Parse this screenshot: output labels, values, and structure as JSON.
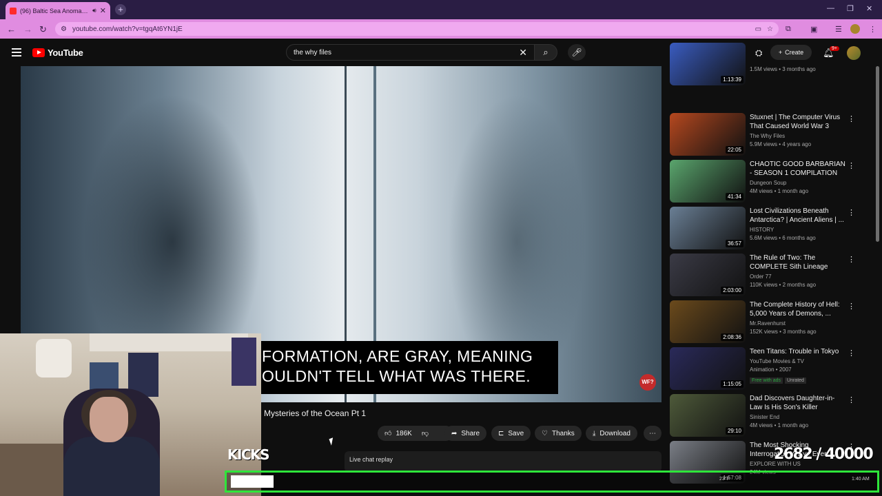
{
  "browser": {
    "tab_title": "(96) Baltic Sea Anomaly, At",
    "url": "youtube.com/watch?v=tgqAt6YN1jE",
    "colors": {
      "accent": "#e08ce0",
      "tabbar": "#2a1d44"
    }
  },
  "youtube": {
    "logo_text": "YouTube",
    "search_value": "the why files",
    "create_label": "Create",
    "notif_count": "9+"
  },
  "video": {
    "caption_line1": "FORMATION, ARE GRAY, MEANING",
    "caption_line2": "OULDN'T TELL WHAT WAS THERE.",
    "channel_badge": "WF?",
    "title": "Mysteries of the Ocean Pt 1",
    "likes": "186K",
    "share_label": "Share",
    "save_label": "Save",
    "thanks_label": "Thanks",
    "download_label": "Download",
    "live_chat_label": "Live chat replay"
  },
  "recommendations": [
    {
      "title": "",
      "channel": "",
      "stats": "1.5M views • 3 months ago",
      "duration": "1:13:39",
      "color": "#3a5cc0"
    },
    {
      "title": "Stuxnet | The Computer Virus That Caused World War 3",
      "channel": "The Why Files",
      "stats": "5.9M views • 4 years ago",
      "duration": "22:05",
      "color": "#b5481f"
    },
    {
      "title": "CHAOTIC GOOD BARBARIAN - SEASON 1 COMPILATION",
      "channel": "Dungeon Soup",
      "stats": "4M views • 1 month ago",
      "duration": "41:34",
      "color": "#5aa56d"
    },
    {
      "title": "Lost Civilizations Beneath Antarctica? | Ancient Aliens | ...",
      "channel": "HISTORY",
      "stats": "5.6M views • 6 months ago",
      "duration": "36:57",
      "color": "#6a7f95"
    },
    {
      "title": "The Rule of Two: The COMPLETE Sith Lineage (Ever...",
      "channel": "Order 77",
      "stats": "110K views • 2 months ago",
      "duration": "2:03:00",
      "color": "#3b3b46"
    },
    {
      "title": "The Complete History of Hell: 5,000 Years of Demons, ...",
      "channel": "Mr.Ravenhurst",
      "stats": "152K views • 3 months ago",
      "duration": "2:08:36",
      "color": "#6b4a1c"
    },
    {
      "title": "Teen Titans: Trouble in Tokyo",
      "channel": "YouTube Movies & TV",
      "stats": "Animation • 2007",
      "duration": "1:15:05",
      "color": "#2a2a5a",
      "badges": [
        "Free with ads",
        "Unrated"
      ]
    },
    {
      "title": "Dad Discovers Daughter-in-Law Is His Son's Killer",
      "channel": "Sinister End",
      "stats": "4M views • 1 month ago",
      "duration": "29:10",
      "color": "#4e5a3a"
    },
    {
      "title": "The Most Shocking Interrogation You've Ever See...",
      "channel": "EXPLORE WITH US",
      "stats": "24M views",
      "duration": "1:57:08",
      "color": "#7a7e86"
    }
  ],
  "overlay": {
    "kicks_label": "KICKS",
    "goal_current": "2682",
    "goal_separator": "/",
    "goal_target": "40000",
    "goal_progress": 0.067,
    "goal_color": "#2ee63a"
  },
  "taskbar": {
    "weather": "23°F",
    "time": "1:40 AM"
  }
}
